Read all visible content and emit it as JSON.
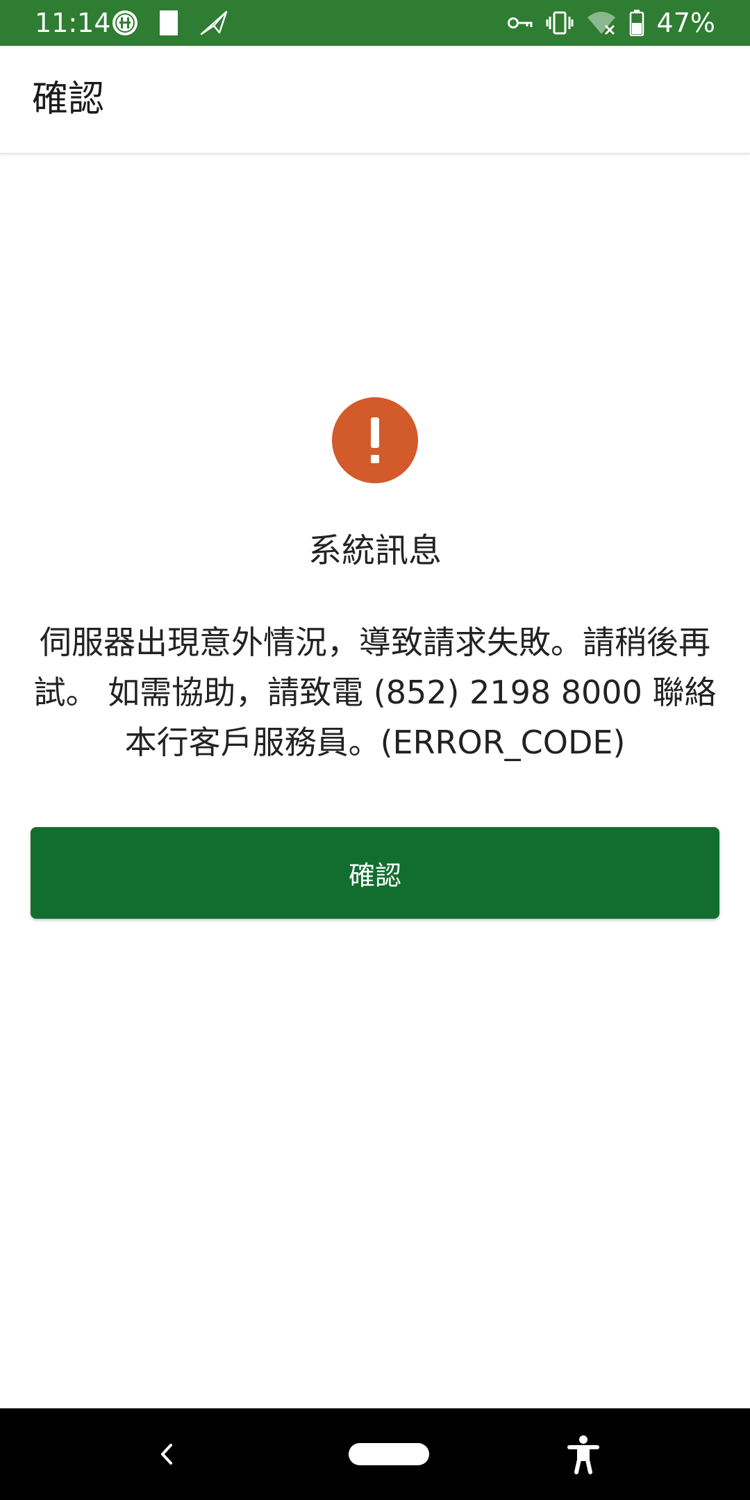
{
  "status_bar": {
    "time": "11:14",
    "battery": "47%",
    "background_color": "#2e7d32",
    "left_icons": [
      "bank-app-icon",
      "sd-card-icon",
      "send-icon"
    ],
    "right_icons": [
      "vpn-key-icon",
      "vibrate-icon",
      "wifi-off-icon",
      "battery-icon"
    ]
  },
  "app_bar": {
    "title": "確認"
  },
  "dialog": {
    "icon": "alert-icon",
    "icon_color": "#d25a2b",
    "title": "系統訊息",
    "message": "伺服器出現意外情況，導致請求失敗。請稍後再試。 如需協助，請致電 (852) 2198 8000 聯絡本行客戶服務員。(ERROR_CODE)",
    "confirm_label": "確認",
    "button_color": "#116e2e"
  },
  "nav_bar": {
    "icons": [
      "back-icon",
      "home-icon",
      "accessibility-icon"
    ]
  }
}
